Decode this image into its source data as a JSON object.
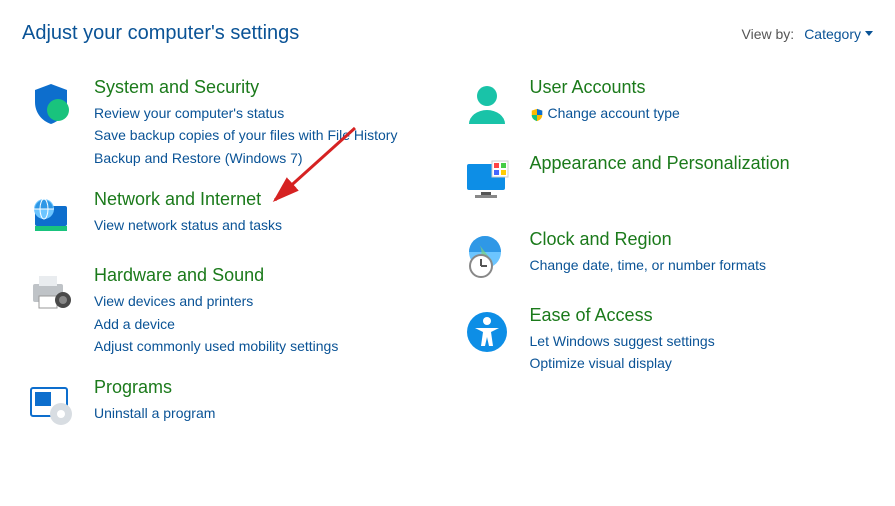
{
  "header": {
    "title": "Adjust your computer's settings",
    "viewby_label": "View by:",
    "viewby_value": "Category"
  },
  "cats": {
    "system": {
      "title": "System and Security",
      "links": [
        "Review your computer's status",
        "Save backup copies of your files with File History",
        "Backup and Restore (Windows 7)"
      ]
    },
    "network": {
      "title": "Network and Internet",
      "links": [
        "View network status and tasks"
      ]
    },
    "hardware": {
      "title": "Hardware and Sound",
      "links": [
        "View devices and printers",
        "Add a device",
        "Adjust commonly used mobility settings"
      ]
    },
    "programs": {
      "title": "Programs",
      "links": [
        "Uninstall a program"
      ]
    },
    "users": {
      "title": "User Accounts",
      "links": [
        "Change account type"
      ]
    },
    "appearance": {
      "title": "Appearance and Personalization",
      "links": []
    },
    "clock": {
      "title": "Clock and Region",
      "links": [
        "Change date, time, or number formats"
      ]
    },
    "ease": {
      "title": "Ease of Access",
      "links": [
        "Let Windows suggest settings",
        "Optimize visual display"
      ]
    }
  }
}
